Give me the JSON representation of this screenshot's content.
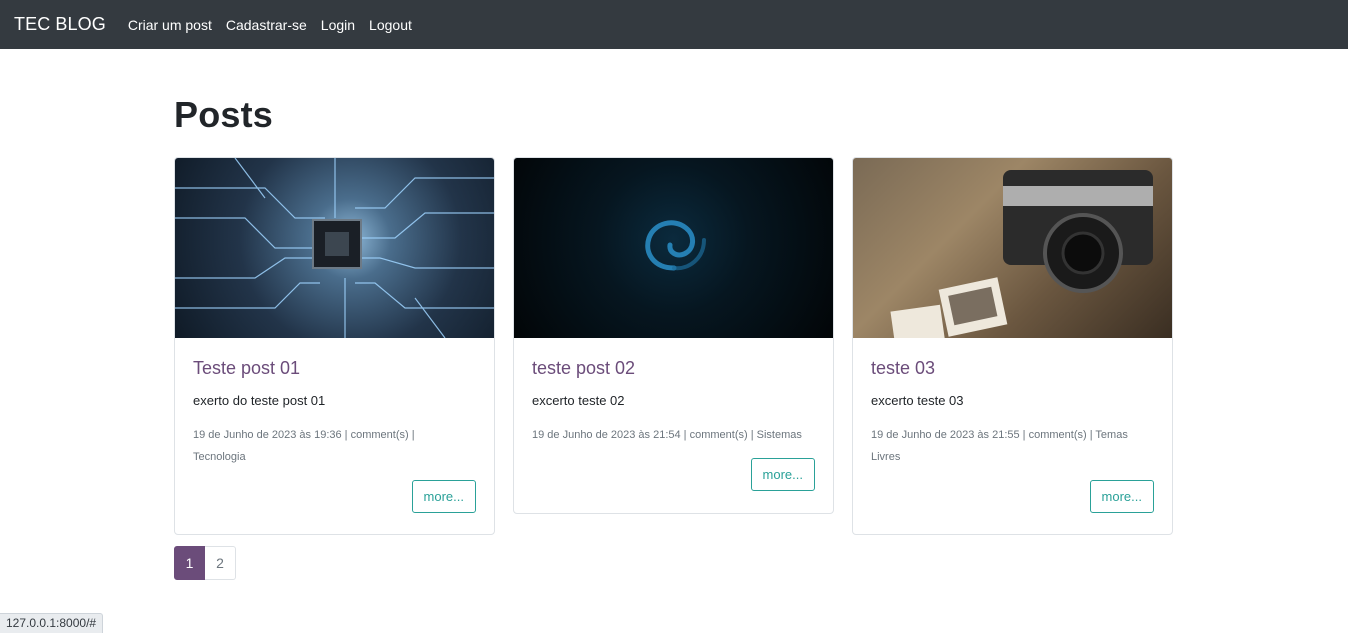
{
  "nav": {
    "brand": "TEC BLOG",
    "links": [
      "Criar um post",
      "Cadastrar-se",
      "Login",
      "Logout"
    ]
  },
  "page": {
    "title": "Posts"
  },
  "posts": [
    {
      "title": "Teste post 01",
      "excerpt": "exerto do teste post 01",
      "meta_line1": "19 de Junho de 2023 às 19:36 | comment(s) |",
      "meta_line2": "Tecnologia",
      "button": "more...",
      "image": "circuit-board-image"
    },
    {
      "title": "teste post 02",
      "excerpt": "excerto teste 02",
      "meta_line1": "19 de Junho de 2023 às 21:54 | comment(s) | Sistemas",
      "meta_line2": "",
      "button": "more...",
      "image": "debian-swirl-image"
    },
    {
      "title": "teste 03",
      "excerpt": "excerto teste 03",
      "meta_line1": "19 de Junho de 2023 às 21:55 | comment(s) | Temas",
      "meta_line2": "Livres",
      "button": "more...",
      "image": "vintage-camera-image"
    }
  ],
  "pagination": {
    "pages": [
      "1",
      "2"
    ],
    "active": "1"
  },
  "status_bar": {
    "url": "127.0.0.1:8000/#"
  },
  "colors": {
    "navbar_bg": "#343a40",
    "title_color": "#6b4c7a",
    "button_accent": "#2aa198",
    "pagination_active": "#6b4c7a"
  }
}
